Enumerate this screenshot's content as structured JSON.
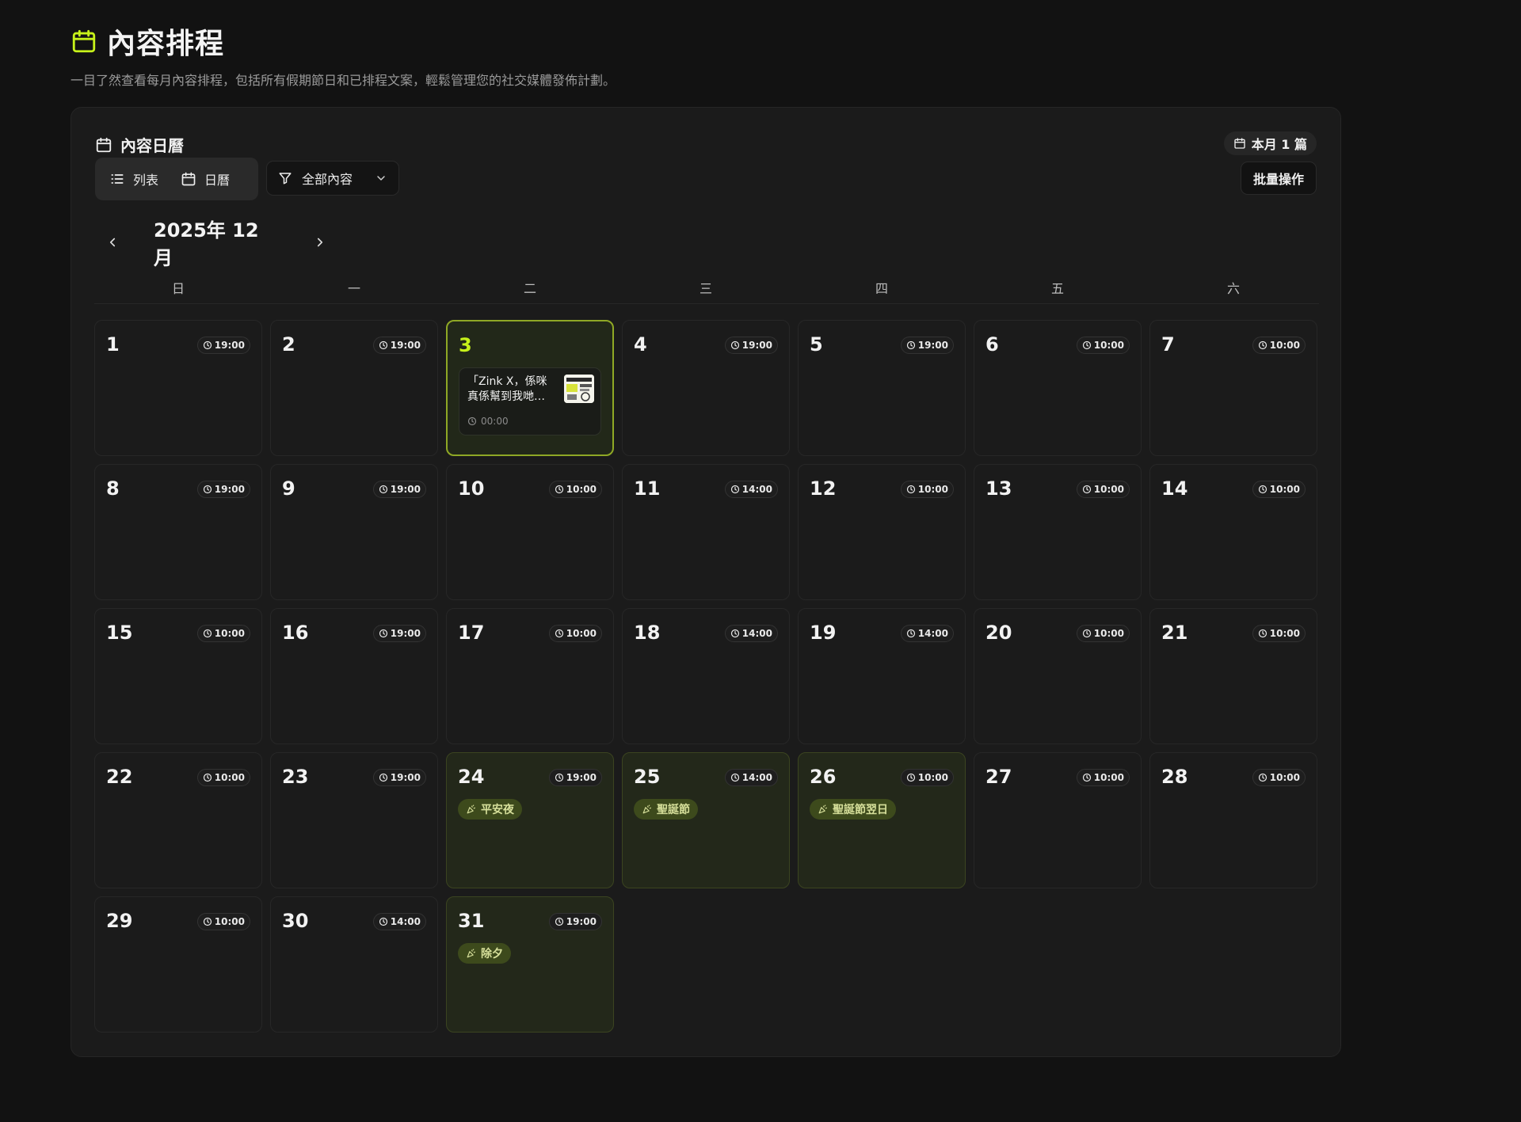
{
  "page": {
    "title": "內容排程",
    "subtitle": "一目了然查看每月內容排程，包括所有假期節日和已排程文案，輕鬆管理您的社交媒體發佈計劃。",
    "title_icon": "calendar-icon",
    "accent_color": "#c7f21a"
  },
  "calendar_card": {
    "title": "內容日曆",
    "month_count": "本月 1 篇",
    "view_switch": {
      "list_label": "列表",
      "calendar_label": "日曆"
    },
    "filter": {
      "selected": "全部內容"
    },
    "bulk_action_label": "批量操作",
    "month_label": "2025年 12月",
    "weekdays": [
      "日",
      "一",
      "二",
      "三",
      "四",
      "五",
      "六"
    ],
    "days": [
      {
        "num": "1",
        "time": "19:00"
      },
      {
        "num": "2",
        "time": "19:00"
      },
      {
        "num": "3",
        "time": "",
        "today": true,
        "post": {
          "title": "「Zink X，係咪真係幫到我哋…",
          "time": "00:00"
        }
      },
      {
        "num": "4",
        "time": "19:00"
      },
      {
        "num": "5",
        "time": "19:00"
      },
      {
        "num": "6",
        "time": "10:00"
      },
      {
        "num": "7",
        "time": "10:00"
      },
      {
        "num": "8",
        "time": "19:00"
      },
      {
        "num": "9",
        "time": "19:00"
      },
      {
        "num": "10",
        "time": "10:00"
      },
      {
        "num": "11",
        "time": "14:00"
      },
      {
        "num": "12",
        "time": "10:00"
      },
      {
        "num": "13",
        "time": "10:00"
      },
      {
        "num": "14",
        "time": "10:00"
      },
      {
        "num": "15",
        "time": "10:00"
      },
      {
        "num": "16",
        "time": "19:00"
      },
      {
        "num": "17",
        "time": "10:00"
      },
      {
        "num": "18",
        "time": "14:00"
      },
      {
        "num": "19",
        "time": "14:00"
      },
      {
        "num": "20",
        "time": "10:00"
      },
      {
        "num": "21",
        "time": "10:00"
      },
      {
        "num": "22",
        "time": "10:00"
      },
      {
        "num": "23",
        "time": "19:00"
      },
      {
        "num": "24",
        "time": "19:00",
        "holiday": "平安夜"
      },
      {
        "num": "25",
        "time": "14:00",
        "holiday": "聖誕節"
      },
      {
        "num": "26",
        "time": "10:00",
        "holiday": "聖誕節翌日"
      },
      {
        "num": "27",
        "time": "10:00"
      },
      {
        "num": "28",
        "time": "10:00"
      },
      {
        "num": "29",
        "time": "10:00"
      },
      {
        "num": "30",
        "time": "14:00"
      },
      {
        "num": "31",
        "time": "19:00",
        "holiday": "除夕"
      }
    ]
  }
}
